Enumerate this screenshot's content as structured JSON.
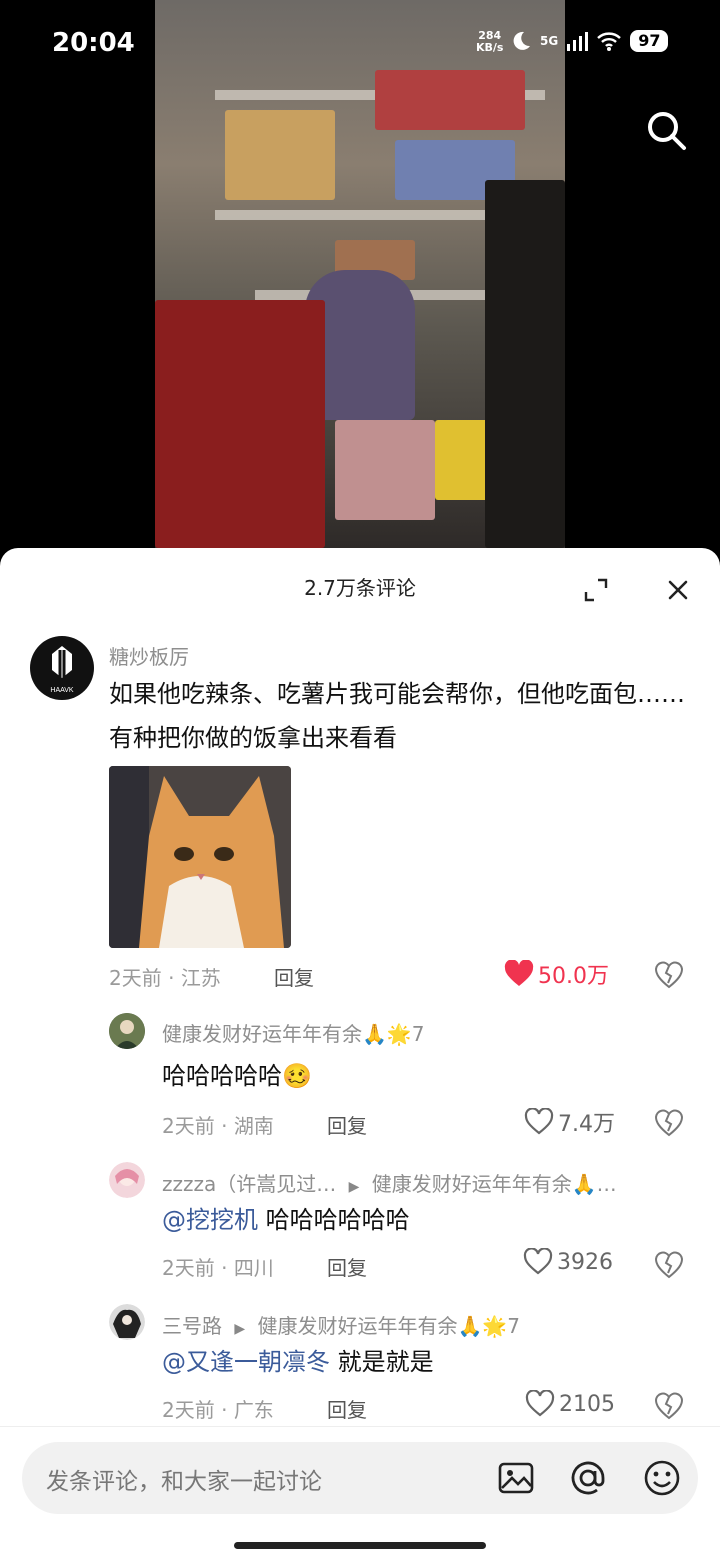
{
  "status_bar": {
    "time": "20:04",
    "speed_value": "284",
    "speed_unit": "KB/s",
    "network": "5G",
    "wifi_label": "6",
    "battery": "97"
  },
  "comments_header": {
    "title": "2.7万条评论"
  },
  "main_comment": {
    "username": "糖炒板厉",
    "avatar_text": "HAAVK",
    "text": "如果他吃辣条、吃薯片我可能会帮你，但他吃面包……有种把你做的饭拿出来看看",
    "time": "2天前",
    "location": "江苏",
    "reply_label": "回复",
    "likes": "50.0万"
  },
  "replies": [
    {
      "username": "健康发财好运年年有余🙏🌟7",
      "text": "哈哈哈哈哈🥴",
      "mention": "",
      "reply_to": "",
      "time": "2天前",
      "location": "湖南",
      "reply_label": "回复",
      "likes": "7.4万"
    },
    {
      "username": "zzzza（许嵩见过…",
      "reply_to": "健康发财好运年年有余🙏…",
      "mention": "@挖挖机",
      "text": "哈哈哈哈哈哈",
      "time": "2天前",
      "location": "四川",
      "reply_label": "回复",
      "likes": "3926"
    },
    {
      "username": "三号路",
      "reply_to": "健康发财好运年年有余🙏🌟7",
      "mention": "@又逢一朝凛冬",
      "text": "就是就是",
      "time": "2天前",
      "location": "广东",
      "reply_label": "回复",
      "likes": "2105"
    }
  ],
  "input": {
    "placeholder": "发条评论，和大家一起讨论"
  },
  "colors": {
    "like_active": "#f0334f",
    "mention": "#3b5b9a"
  }
}
